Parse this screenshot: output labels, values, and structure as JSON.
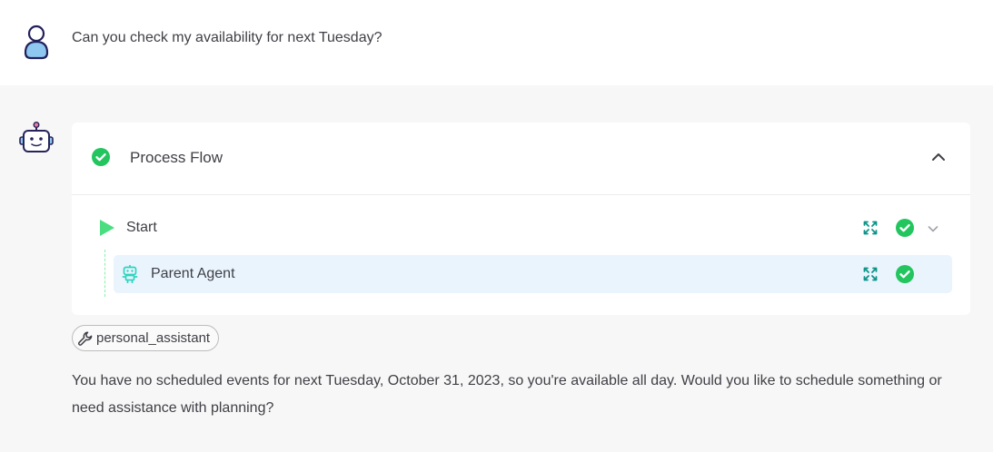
{
  "user_message": {
    "text": "Can you check my availability for next Tuesday?"
  },
  "assistant": {
    "process_flow": {
      "title": "Process Flow",
      "status": "completed",
      "expanded": true,
      "steps": [
        {
          "label": "Start",
          "status": "completed",
          "icon": "play-icon"
        },
        {
          "label": "Parent Agent",
          "status": "completed",
          "icon": "robot-icon"
        }
      ]
    },
    "tool": {
      "label": "personal_assistant",
      "icon": "wrench-icon"
    },
    "response": "You have no scheduled events for next Tuesday, October 31, 2023, so you're available all day. Would you like to schedule something or need assistance with planning?"
  },
  "colors": {
    "success": "#22c55e",
    "accent": "#0d9488",
    "bot_avatar_border": "#27245c",
    "highlight_row": "#eaf4fd"
  }
}
